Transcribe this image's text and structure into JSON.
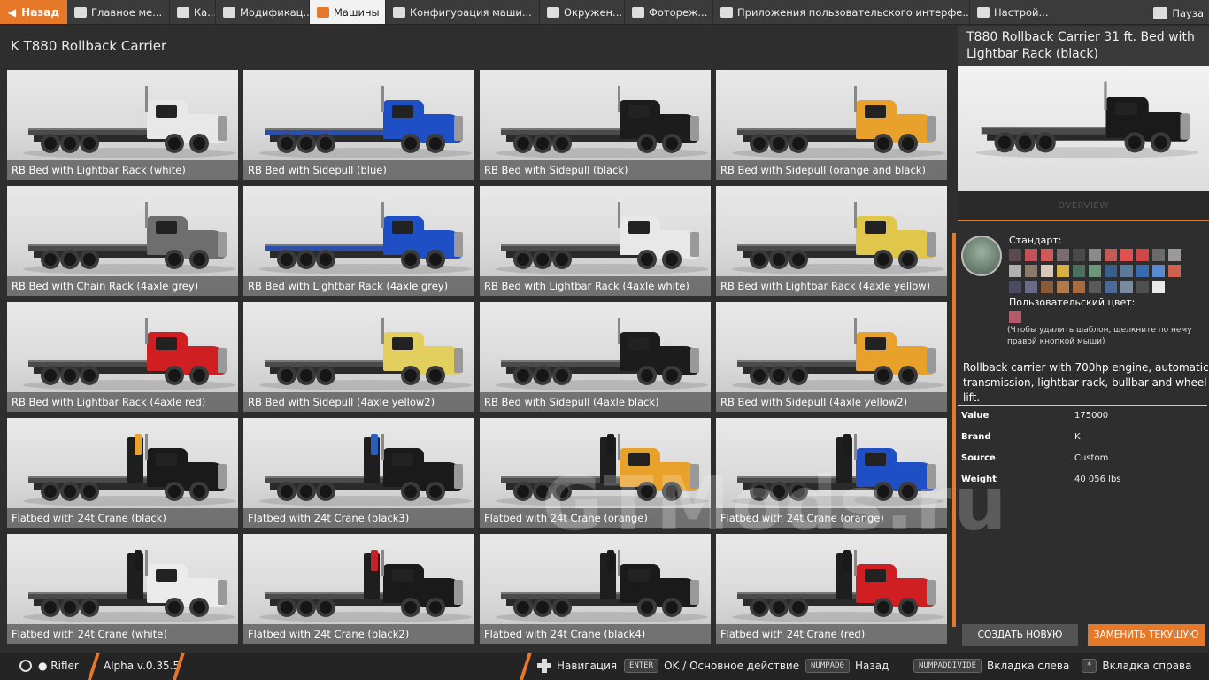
{
  "topbar": {
    "back_label": "Назад",
    "tabs": [
      {
        "label": "Главное ме...",
        "icon": "grid-icon",
        "active": false
      },
      {
        "label": "Ка...",
        "icon": "map-icon",
        "active": false
      },
      {
        "label": "Модификац...",
        "icon": "puzzle-icon",
        "active": false
      },
      {
        "label": "Машины",
        "icon": "car-icon",
        "active": true
      },
      {
        "label": "Конфигурация маши...",
        "icon": "truck-config-icon",
        "active": false
      },
      {
        "label": "Окружен...",
        "icon": "weather-icon",
        "active": false
      },
      {
        "label": "Фотореж...",
        "icon": "camera-icon",
        "active": false
      },
      {
        "label": "Приложения пользовательского интерфе...",
        "icon": "apps-icon",
        "active": false
      },
      {
        "label": "Настрой...",
        "icon": "sliders-icon",
        "active": false
      }
    ],
    "pause_label": "Пауза"
  },
  "list": {
    "title": "K T880 Rollback Carrier",
    "vehicles": [
      {
        "label": "RB Bed with Lightbar Rack (white)",
        "color": "#e8e8e8",
        "type": "bed"
      },
      {
        "label": "RB Bed with Sidepull (blue)",
        "color": "#1f4fc4",
        "type": "bed-blue"
      },
      {
        "label": "RB Bed with Sidepull (black)",
        "color": "#1c1c1c",
        "type": "bed"
      },
      {
        "label": "RB Bed with Sidepull (orange and black)",
        "color": "#e8a12a",
        "type": "bed"
      },
      {
        "label": "RB Bed with Chain Rack (4axle grey)",
        "color": "#6e6e6e",
        "type": "bed"
      },
      {
        "label": "RB Bed with Lightbar Rack (4axle grey)",
        "color": "#1f4fc4",
        "type": "bed-blue"
      },
      {
        "label": "RB Bed with Lightbar Rack (4axle white)",
        "color": "#e8e8e8",
        "type": "bed"
      },
      {
        "label": "RB Bed with Lightbar Rack (4axle yellow)",
        "color": "#e0c64a",
        "type": "bed"
      },
      {
        "label": "RB Bed with Lightbar Rack (4axle red)",
        "color": "#cf1f22",
        "type": "bed"
      },
      {
        "label": "RB Bed with Sidepull (4axle yellow2)",
        "color": "#e3cf5e",
        "type": "bed"
      },
      {
        "label": "RB Bed with Sidepull (4axle black)",
        "color": "#1c1c1c",
        "type": "bed"
      },
      {
        "label": "RB Bed with Sidepull (4axle yellow2)",
        "color": "#e8a12a",
        "type": "bed"
      },
      {
        "label": "Flatbed with 24t Crane (black)",
        "color": "#1a1a1a",
        "type": "crane",
        "crane_color": "#e8a12a"
      },
      {
        "label": "Flatbed with 24t Crane (black3)",
        "color": "#1a1a1a",
        "type": "crane",
        "crane_color": "#2a5fc0"
      },
      {
        "label": "Flatbed with 24t Crane (orange)",
        "color": "#e8a12a",
        "type": "crane",
        "crane_color": "#1a1a1a"
      },
      {
        "label": "Flatbed with 24t Crane (orange)",
        "color": "#1f4fc4",
        "type": "crane",
        "crane_color": "#1a1a1a"
      },
      {
        "label": "Flatbed with 24t Crane (white)",
        "color": "#ebebeb",
        "type": "crane",
        "crane_color": "#1a1a1a"
      },
      {
        "label": "Flatbed with 24t Crane (black2)",
        "color": "#1a1a1a",
        "type": "crane",
        "crane_color": "#c8202a"
      },
      {
        "label": "Flatbed with 24t Crane (black4)",
        "color": "#1a1a1a",
        "type": "crane",
        "crane_color": "#1a1a1a"
      },
      {
        "label": "Flatbed with 24t Crane (red)",
        "color": "#cf1f22",
        "type": "crane",
        "crane_color": "#1a1a1a"
      }
    ]
  },
  "preview": {
    "title": "T880 Rollback Carrier 31 ft. Bed with Lightbar Rack (black)",
    "color": "#1a1a1a",
    "overview_label": "OVERVIEW"
  },
  "config": {
    "standard_label": "Стандарт:",
    "swatches": [
      "#5a4a4e",
      "#c4505a",
      "#d05a5a",
      "#7b6a70",
      "#4a4a4a",
      "#8a8a8a",
      "#c25a58",
      "#e05050",
      "#d04545",
      "#6a6a6a",
      "#9a9a9a",
      "#b0b0b0",
      "#8a7a6a",
      "#d8c8b8",
      "#d8b040",
      "#4a7060",
      "#6a9878",
      "#3a5f8a",
      "#5a7a9a",
      "#3a6ab0",
      "#5a8ad0",
      "#d06050",
      "#4a4a60",
      "#6a6a8a",
      "#8a5a3a",
      "#b07a4a",
      "#aa6a40",
      "#5a5a5a",
      "#4a6a9a",
      "#7a8aa0",
      "#505050",
      "#e8e8e8"
    ],
    "custom_label": "Пользовательский цвет:",
    "custom_color": "#b55a6a",
    "hint": "(Чтобы удалить шаблон, щелкните по нему правой кнопкой мыши)",
    "description": "Rollback carrier with 700hp engine, automatic transmission, lightbar rack, bullbar and wheel lift.",
    "info": [
      {
        "key": "Value",
        "value": "175000"
      },
      {
        "key": "Brand",
        "value": "K"
      },
      {
        "key": "Source",
        "value": "Custom"
      },
      {
        "key": "Weight",
        "value": "40 056 lbs"
      }
    ],
    "create_label": "СОЗДАТЬ НОВУЮ",
    "replace_label": "ЗАМЕНИТЬ ТЕКУЩУЮ"
  },
  "watermark": "GTMods.ru",
  "bottombar": {
    "user": "Rifler",
    "version": "Alpha v.0.35.5",
    "nav_label": "Навигация",
    "key_enter": "ENTER",
    "enter_action": "OK / Основное действие",
    "key_numpad0": "NUMPAD0",
    "numpad0_action": "Назад",
    "key_numpaddivide": "NUMPADDIVIDE",
    "divide_action": "Вкладка слева",
    "key_mult": "*",
    "mult_action": "Вкладка справа"
  }
}
